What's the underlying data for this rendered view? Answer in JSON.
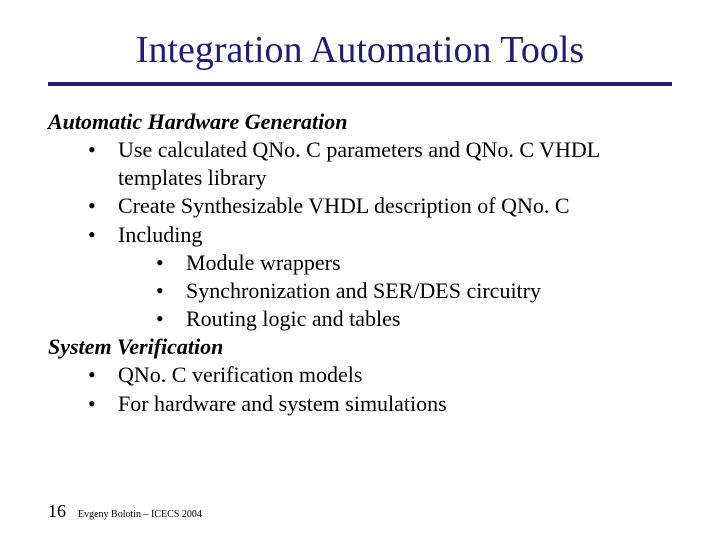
{
  "title": "Integration Automation Tools",
  "section1": {
    "heading": "Automatic Hardware Generation",
    "b1": "Use calculated QNo. C parameters and QNo. C VHDL templates library",
    "b2": "Create Synthesizable VHDL description of QNo. C",
    "b3": "Including",
    "sub1": "Module wrappers",
    "sub2": "Synchronization and SER/DES circuitry",
    "sub3": "Routing logic and tables"
  },
  "section2": {
    "heading": "System Verification",
    "b1": "QNo. C verification models",
    "b2": "For hardware and system simulations"
  },
  "footer": {
    "page": "16",
    "text": "Evgeny Bolotin – ICECS 2004"
  },
  "bullet": "•"
}
